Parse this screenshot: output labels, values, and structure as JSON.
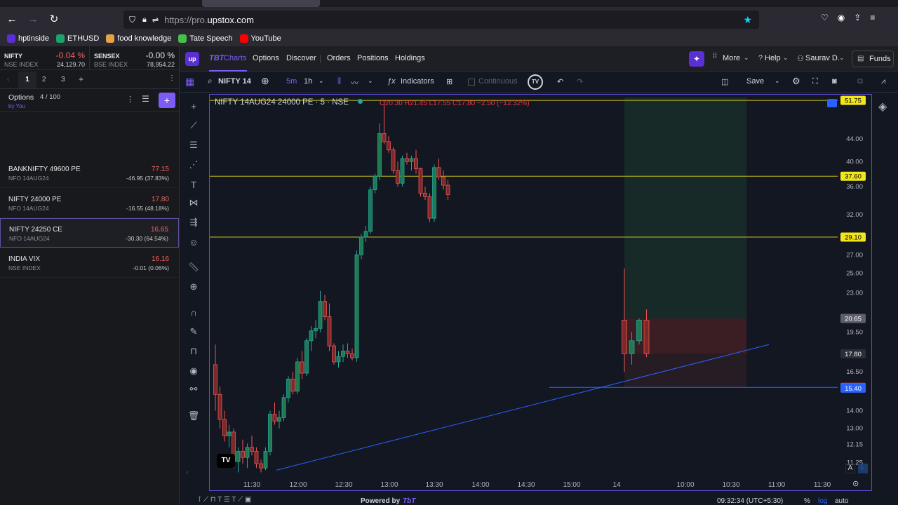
{
  "browser": {
    "url_prefix": "https://pro.",
    "url_host": "upstox.com"
  },
  "bookmarks": [
    {
      "label": "hptinside",
      "color": "#5a2fd6"
    },
    {
      "label": "ETHUSD",
      "color": "#1ba36b"
    },
    {
      "label": "food knowledge",
      "color": "#e2a34a"
    },
    {
      "label": "Tate Speech",
      "color": "#45c14a"
    },
    {
      "label": "YouTube",
      "color": "#ff0000"
    }
  ],
  "indices": [
    {
      "name": "NIFTY",
      "change": "-0.04 %",
      "sub": "NSE INDEX",
      "value": "24,129.70",
      "change_color": "#f0625d"
    },
    {
      "name": "SENSEX",
      "change": "-0.00 %",
      "sub": "BSE INDEX",
      "value": "78,954.22",
      "change_color": "#e5e5e5"
    }
  ],
  "watchlist": {
    "tabs": [
      "1",
      "2",
      "3"
    ],
    "add_tab": "+",
    "title": "Options",
    "count": "4 / 100",
    "by": "by You",
    "items": [
      {
        "name": "BANKNIFTY 49600 PE",
        "sub": "NFO 14AUG24",
        "price": "77.15",
        "change": "-46.95 (37.83%)"
      },
      {
        "name": "NIFTY 24000 PE",
        "sub": "NFO 14AUG24",
        "price": "17.80",
        "change": "-16.55 (48.18%)"
      },
      {
        "name": "NIFTY 24250 CE",
        "sub": "NFO 14AUG24",
        "price": "16.65",
        "change": "-30.30 (64.54%)"
      },
      {
        "name": "INDIA VIX",
        "sub": "NSE INDEX",
        "price": "16.16",
        "change": "-0.01 (0.06%)"
      }
    ]
  },
  "topnav": {
    "logo": "up",
    "tbt": "TBT",
    "charts": "Charts",
    "items": [
      "Options",
      "Discover",
      "Orders",
      "Positions",
      "Holdings"
    ],
    "more": "More",
    "help": "Help",
    "user": "Saurav D.",
    "funds": "Funds"
  },
  "toolbar": {
    "symbol": "NIFTY 14",
    "tf_5m": "5m",
    "tf_1h": "1h",
    "indicators": "Indicators",
    "continuous": "Continuous",
    "save": "Save"
  },
  "legend": {
    "title": "NIFTY 14AUG24 24000 PE · 5 · NSE",
    "o": "O20.30",
    "h": "H21.45",
    "l": "L17.55",
    "c": "C17.80",
    "chg": "−2.50 (−12.32%)"
  },
  "bottom": {
    "powered": "Powered by",
    "brand": "TbT",
    "time": "09:32:34 (UTC+5:30)",
    "pct": "%",
    "log": "log",
    "auto": "auto"
  },
  "chart_data": {
    "type": "candlestick",
    "title": "NIFTY 14AUG24 24000 PE · 5 · NSE",
    "y_ticks": [
      "44.00",
      "40.00",
      "36.00",
      "32.00",
      "27.00",
      "25.00",
      "23.00",
      "19.50",
      "16.50",
      "14.00",
      "13.00",
      "12.15",
      "11.25"
    ],
    "x_ticks": [
      "11:30",
      "12:00",
      "12:30",
      "13:00",
      "13:30",
      "14:00",
      "14:30",
      "15:00",
      "14",
      "10:00",
      "10:30",
      "11:00",
      "11:30"
    ],
    "ylim": [
      10.5,
      53
    ],
    "price_tags": [
      {
        "label": "51.75",
        "value": 51.75,
        "bg": "#f2e51b",
        "fg": "#000"
      },
      {
        "label": "37.60",
        "value": 37.6,
        "bg": "#f2e51b",
        "fg": "#000"
      },
      {
        "label": "29.10",
        "value": 29.1,
        "bg": "#f2e51b",
        "fg": "#000"
      },
      {
        "label": "20.65",
        "value": 20.65,
        "bg": "#5d606b",
        "fg": "#fff"
      },
      {
        "label": "17.80",
        "value": 17.8,
        "bg": "#2a2e39",
        "fg": "#fff"
      },
      {
        "label": "15.45",
        "value": 15.45,
        "bg": "#f23645",
        "fg": "#fff"
      },
      {
        "label": "15.40",
        "value": 15.4,
        "bg": "#2962ff",
        "fg": "#fff"
      }
    ],
    "hlines": [
      51.75,
      37.6,
      29.1
    ],
    "session1": [
      [
        17,
        18.5,
        14,
        15
      ],
      [
        15,
        15.5,
        13,
        13.5
      ],
      [
        13.5,
        14,
        12.3,
        12.6
      ],
      [
        12.6,
        13.2,
        12,
        12.8
      ],
      [
        12.8,
        13,
        11,
        11.3
      ],
      [
        11.3,
        12,
        10.8,
        11.8
      ],
      [
        11.8,
        12.4,
        11.2,
        11.5
      ],
      [
        11.5,
        12.2,
        11,
        12
      ],
      [
        12,
        12.6,
        11.6,
        11.8
      ],
      [
        11.8,
        12,
        11,
        11.2
      ],
      [
        11.2,
        11.4,
        10.8,
        11
      ],
      [
        11,
        12,
        10.9,
        11.8
      ],
      [
        11.8,
        14,
        11.6,
        13.8
      ],
      [
        13.8,
        14.5,
        13.2,
        13.4
      ],
      [
        13.4,
        14,
        13,
        13.6
      ],
      [
        13.6,
        15,
        13.4,
        14.8
      ],
      [
        14.8,
        16.2,
        14.5,
        16
      ],
      [
        16,
        16.5,
        15,
        15.2
      ],
      [
        15.2,
        17.5,
        15,
        17.2
      ],
      [
        17.2,
        18,
        16,
        16.4
      ],
      [
        16.4,
        19,
        16.2,
        18.8
      ],
      [
        18.8,
        20,
        18,
        19.6
      ],
      [
        19.6,
        20.5,
        19,
        19.8
      ],
      [
        19.8,
        23.2,
        19.5,
        22.2
      ],
      [
        22.2,
        22.8,
        20.5,
        20.8
      ],
      [
        20.8,
        22,
        18,
        18.4
      ],
      [
        18.4,
        18.6,
        17,
        17.2
      ],
      [
        17.2,
        18,
        16.8,
        17.6
      ],
      [
        17.6,
        18.5,
        17.2,
        18
      ],
      [
        18,
        18.6,
        17.5,
        17.8
      ],
      [
        17.8,
        18.2,
        17.3,
        17.5
      ],
      [
        17.5,
        27.5,
        17.2,
        27
      ],
      [
        27,
        29.5,
        26.5,
        29.1
      ],
      [
        29.1,
        30.5,
        28.5,
        29.8
      ],
      [
        29.8,
        36,
        29.5,
        35.5
      ],
      [
        35.5,
        38,
        35,
        37.6
      ],
      [
        37.6,
        47,
        37,
        45
      ],
      [
        45,
        51.75,
        43,
        43.5
      ],
      [
        43.5,
        44.5,
        41.5,
        42
      ],
      [
        42,
        42.5,
        38,
        38.5
      ],
      [
        38.5,
        40,
        36,
        36.5
      ],
      [
        36.5,
        41,
        36,
        40.5
      ],
      [
        40.5,
        41.5,
        39.5,
        40
      ],
      [
        40,
        41,
        38.5,
        40.5
      ],
      [
        40.5,
        42,
        38,
        38.8
      ],
      [
        38.8,
        39,
        34.5,
        35
      ],
      [
        35,
        36,
        34,
        34.5
      ],
      [
        34.5,
        35,
        31,
        31.5
      ],
      [
        31.5,
        39.5,
        31,
        39
      ],
      [
        39,
        40.5,
        37,
        37.5
      ],
      [
        37.5,
        38.5,
        35.5,
        36.2
      ],
      [
        36.2,
        37,
        34,
        34.8
      ]
    ],
    "session2": [
      [
        20.5,
        25.5,
        16.5,
        17.8
      ],
      [
        17.8,
        19.5,
        17,
        18.8
      ],
      [
        18.8,
        20.65,
        18.5,
        20.5
      ],
      [
        20.5,
        21.45,
        17.55,
        17.8
      ]
    ],
    "trendline": {
      "from": [
        "11:40",
        10.9
      ],
      "to": [
        "10:50",
        18.5
      ]
    },
    "support_line": 15.45
  }
}
